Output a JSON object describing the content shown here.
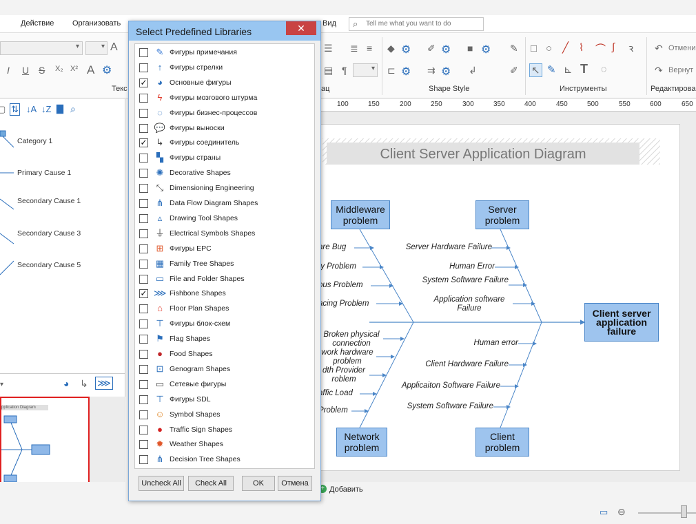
{
  "menubar": {
    "items": [
      "Действие",
      "Организовать",
      "Вид"
    ],
    "tell_me_placeholder": "Tell me what you want to do"
  },
  "ribbon": {
    "groups": [
      "Текс",
      "ац",
      "Shape Style",
      "Инструменты",
      "Редактирова"
    ],
    "undo_label": "Отмени",
    "redo_label": "Вернут",
    "font_size_label": "A"
  },
  "left_panel": {
    "tree": [
      "Category 1",
      "Primary Cause 1",
      "Secondary Cause 1",
      "Secondary Cause 3",
      "Secondary Cause 5"
    ],
    "thumb_title": "pplication Diagram"
  },
  "ruler": [
    "100",
    "150",
    "200",
    "250",
    "300",
    "350",
    "400",
    "450",
    "500",
    "550",
    "600",
    "650"
  ],
  "diagram": {
    "title": "Client Server Application Diagram",
    "boxes": {
      "middleware": "Middleware problem",
      "server": "Server problem",
      "network": "Network problem",
      "client": "Client problem",
      "effect": "Client server application failure"
    },
    "causes_top_left": [
      "are Bug",
      "ty Problem",
      "ous Problem",
      "acing Problem"
    ],
    "causes_top_right": [
      "Server Hardware Failure",
      "Human Error",
      "System Software Failure",
      "Application software Failure"
    ],
    "causes_bottom_left": [
      "Broken physical connection",
      "work hardware problem",
      "dth Provider roblem",
      "affic Load",
      "Problem"
    ],
    "causes_bottom_right": [
      "Human error",
      "Client Hardware Failure",
      "Applicaiton Software Failure",
      "System Software Failure"
    ]
  },
  "status": {
    "add_label": "Добавить"
  },
  "dialog": {
    "title": "Select Predefined Libraries",
    "close": "✕",
    "libraries": [
      {
        "label": "Фигуры примечания",
        "checked": false,
        "icon": "note-icon",
        "glyph": "✎",
        "color": "#3a7bd5"
      },
      {
        "label": "Фигуры стрелки",
        "checked": false,
        "icon": "arrow-up-icon",
        "glyph": "↑",
        "color": "#2a6ebb"
      },
      {
        "label": "Основные фигуры",
        "checked": true,
        "icon": "basic-shapes-icon",
        "glyph": "◕",
        "color": "#2a6ebb"
      },
      {
        "label": "Фигуры мозгового штурма",
        "checked": false,
        "icon": "lightning-icon",
        "glyph": "ϟ",
        "color": "#e03a2a"
      },
      {
        "label": "Фигуры бизнес-процессов",
        "checked": false,
        "icon": "process-icon",
        "glyph": "◌",
        "color": "#2a6ebb"
      },
      {
        "label": "Фигуры выноски",
        "checked": false,
        "icon": "callout-icon",
        "glyph": "💬",
        "color": "#2a6ebb"
      },
      {
        "label": "Фигуры соединитель",
        "checked": true,
        "icon": "connector-icon",
        "glyph": "↳",
        "color": "#444444"
      },
      {
        "label": "Фигуры страны",
        "checked": false,
        "icon": "map-icon",
        "glyph": "▚",
        "color": "#2a6ebb"
      },
      {
        "label": "Decorative Shapes",
        "checked": false,
        "icon": "decorative-icon",
        "glyph": "✺",
        "color": "#2a6ebb"
      },
      {
        "label": "Dimensioning Engineering",
        "checked": false,
        "icon": "dimension-icon",
        "glyph": "⤡",
        "color": "#444444"
      },
      {
        "label": "Data Flow Diagram Shapes",
        "checked": false,
        "icon": "dataflow-icon",
        "glyph": "⋔",
        "color": "#2a6ebb"
      },
      {
        "label": "Drawing Tool Shapes",
        "checked": false,
        "icon": "drawing-icon",
        "glyph": "▵",
        "color": "#2a6ebb"
      },
      {
        "label": "Electrical Symbols Shapes",
        "checked": false,
        "icon": "electrical-icon",
        "glyph": "⏚",
        "color": "#444444"
      },
      {
        "label": "Фигуры EPC",
        "checked": false,
        "icon": "epc-icon",
        "glyph": "⊞",
        "color": "#e0572a"
      },
      {
        "label": "Family Tree Shapes",
        "checked": false,
        "icon": "family-tree-icon",
        "glyph": "▦",
        "color": "#2a6ebb"
      },
      {
        "label": "File and Folder Shapes",
        "checked": false,
        "icon": "folder-icon",
        "glyph": "▭",
        "color": "#2a6ebb"
      },
      {
        "label": "Fishbone Shapes",
        "checked": true,
        "icon": "fishbone-icon",
        "glyph": "⋙",
        "color": "#2a6ebb"
      },
      {
        "label": "Floor Plan Shapes",
        "checked": false,
        "icon": "house-icon",
        "glyph": "⌂",
        "color": "#e03a2a"
      },
      {
        "label": "Фигуры блок-схем",
        "checked": false,
        "icon": "flowchart-icon",
        "glyph": "⊤",
        "color": "#2a6ebb"
      },
      {
        "label": "Flag Shapes",
        "checked": false,
        "icon": "flag-icon",
        "glyph": "⚑",
        "color": "#2a6ebb"
      },
      {
        "label": "Food Shapes",
        "checked": false,
        "icon": "cherry-icon",
        "glyph": "●",
        "color": "#c0262a"
      },
      {
        "label": "Genogram Shapes",
        "checked": false,
        "icon": "genogram-icon",
        "glyph": "⊡",
        "color": "#2a6ebb"
      },
      {
        "label": "Сетевые фигуры",
        "checked": false,
        "icon": "monitor-icon",
        "glyph": "▭",
        "color": "#444444"
      },
      {
        "label": "Фигуры SDL",
        "checked": false,
        "icon": "sdl-icon",
        "glyph": "⊤",
        "color": "#2a6ebb"
      },
      {
        "label": "Symbol Shapes",
        "checked": false,
        "icon": "person-icon",
        "glyph": "☺",
        "color": "#e0892a"
      },
      {
        "label": "Traffic Sign Shapes",
        "checked": false,
        "icon": "stop-sign-icon",
        "glyph": "●",
        "color": "#d42020"
      },
      {
        "label": "Weather Shapes",
        "checked": false,
        "icon": "sun-icon",
        "glyph": "✹",
        "color": "#e0572a"
      },
      {
        "label": "Decision Tree Shapes",
        "checked": false,
        "icon": "decision-tree-icon",
        "glyph": "⋔",
        "color": "#2a6ebb"
      }
    ],
    "buttons": {
      "uncheck_all": "Uncheck All",
      "check_all": "Check All",
      "ok": "OK",
      "cancel": "Отмена"
    }
  }
}
